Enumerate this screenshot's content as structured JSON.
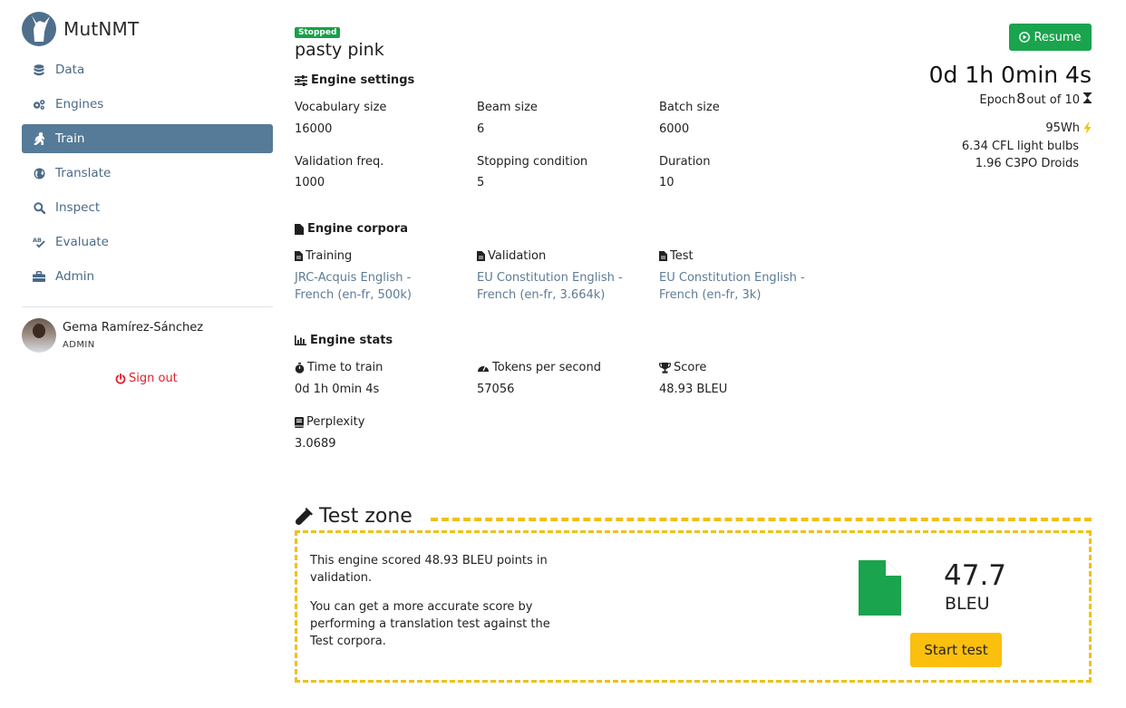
{
  "app": {
    "name": "MutNMT"
  },
  "nav": {
    "items": [
      {
        "label": "Data",
        "icon": "database-icon"
      },
      {
        "label": "Engines",
        "icon": "gears-icon"
      },
      {
        "label": "Train",
        "icon": "running-icon"
      },
      {
        "label": "Translate",
        "icon": "globe-icon"
      },
      {
        "label": "Inspect",
        "icon": "search-icon"
      },
      {
        "label": "Evaluate",
        "icon": "spellcheck-icon"
      },
      {
        "label": "Admin",
        "icon": "toolbox-icon"
      }
    ],
    "active": "Train"
  },
  "user": {
    "name": "Gema Ramírez-Sánchez",
    "role": "ADMIN"
  },
  "signout_label": "Sign out",
  "engine": {
    "status": "Stopped",
    "name": "pasty pink"
  },
  "settings": {
    "title": "Engine settings",
    "fields": [
      {
        "label": "Vocabulary size",
        "value": "16000"
      },
      {
        "label": "Beam size",
        "value": "6"
      },
      {
        "label": "Batch size",
        "value": "6000"
      },
      {
        "label": "Validation freq.",
        "value": "1000"
      },
      {
        "label": "Stopping condition",
        "value": "5"
      },
      {
        "label": "Duration",
        "value": "10"
      }
    ]
  },
  "corpora": {
    "title": "Engine corpora",
    "items": [
      {
        "label": "Training",
        "value_line1": "JRC-Acquis English -",
        "value_line2": "French (en-fr, 500k)"
      },
      {
        "label": "Validation",
        "value_line1": "EU Constitution English -",
        "value_line2": "French (en-fr, 3.664k)"
      },
      {
        "label": "Test",
        "value_line1": "EU Constitution English -",
        "value_line2": "French (en-fr, 3k)"
      }
    ]
  },
  "stats": {
    "title": "Engine stats",
    "items": [
      {
        "label": "Time to train",
        "value": "0d 1h 0min 4s"
      },
      {
        "label": "Tokens per second",
        "value": "57056"
      },
      {
        "label": "Score",
        "value": "48.93 BLEU"
      },
      {
        "label": "Perplexity",
        "value": "3.0689"
      }
    ]
  },
  "progress": {
    "resume_label": "Resume",
    "timer": "0d 1h 0min 4s",
    "epoch_prefix": "Epoch",
    "epoch_current": "8",
    "epoch_suffix": "out of 10",
    "energy": "95Wh",
    "bulbs": "6.34 CFL light bulbs",
    "droids": "1.96 C3PO Droids"
  },
  "test_zone": {
    "title": "Test zone",
    "text1": "This engine scored 48.93 BLEU points in validation.",
    "text2": "You can get a more accurate score by performing a translation test against the Test corpora.",
    "score": "47.7",
    "score_unit": "BLEU",
    "start_label": "Start test"
  },
  "colors": {
    "accent": "#557b98",
    "success": "#19a44d",
    "warning": "#fbbf0e",
    "danger": "#e0202c"
  }
}
